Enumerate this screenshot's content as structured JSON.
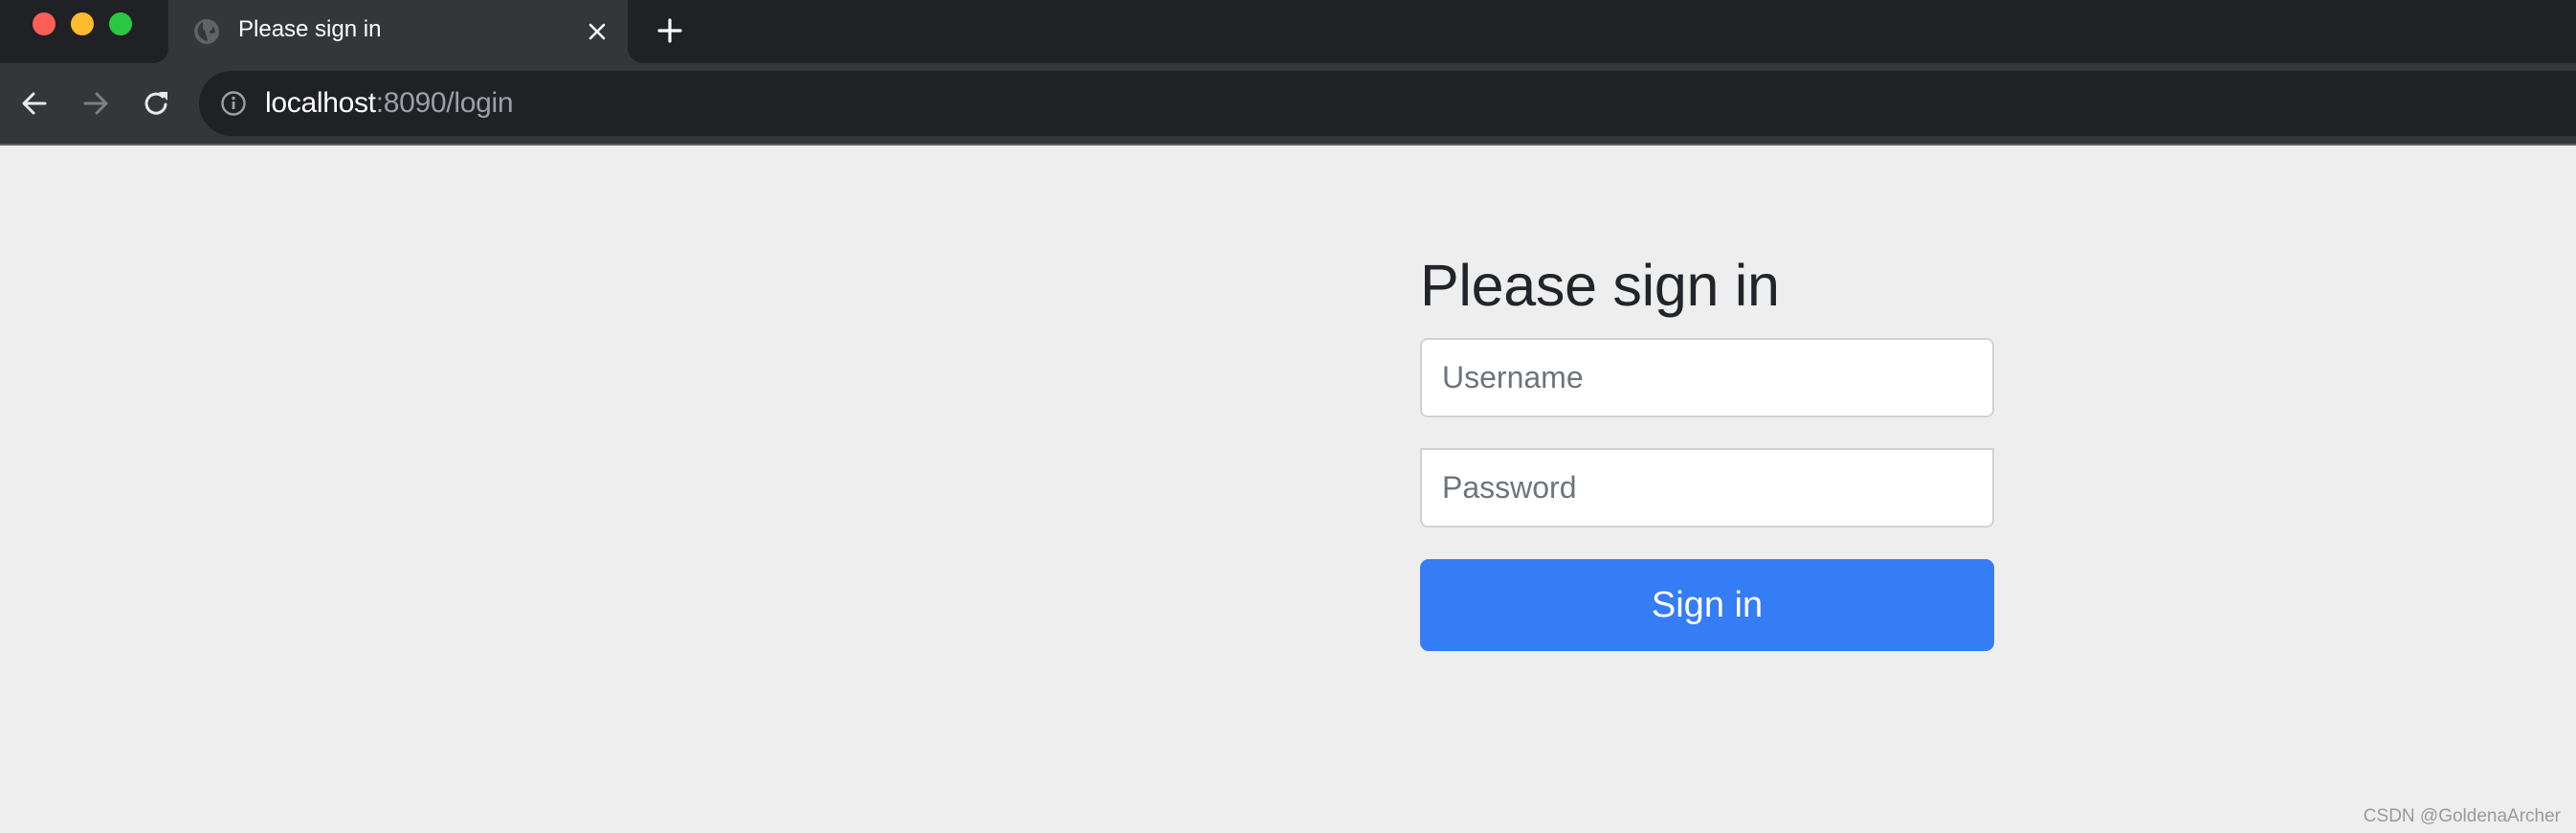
{
  "window": {
    "traffic_lights": {
      "close_color": "#ff5f57",
      "minimize_color": "#febc2e",
      "zoom_color": "#28c840"
    }
  },
  "tabs": [
    {
      "title": "Please sign in",
      "favicon": "globe-icon",
      "active": true,
      "close_icon": "close-icon"
    }
  ],
  "new_tab_icon": "plus-icon",
  "toolbar": {
    "back_icon": "arrow-left-icon",
    "forward_icon": "arrow-right-icon",
    "reload_icon": "reload-icon",
    "site_info_icon": "info-icon",
    "url_host": "localhost",
    "url_rest": ":8090/login"
  },
  "login": {
    "heading": "Please sign in",
    "username": {
      "placeholder": "Username",
      "value": ""
    },
    "password": {
      "placeholder": "Password",
      "value": ""
    },
    "submit_label": "Sign in",
    "accent_color": "#357df5"
  },
  "watermark": "CSDN @GoldenaArcher"
}
